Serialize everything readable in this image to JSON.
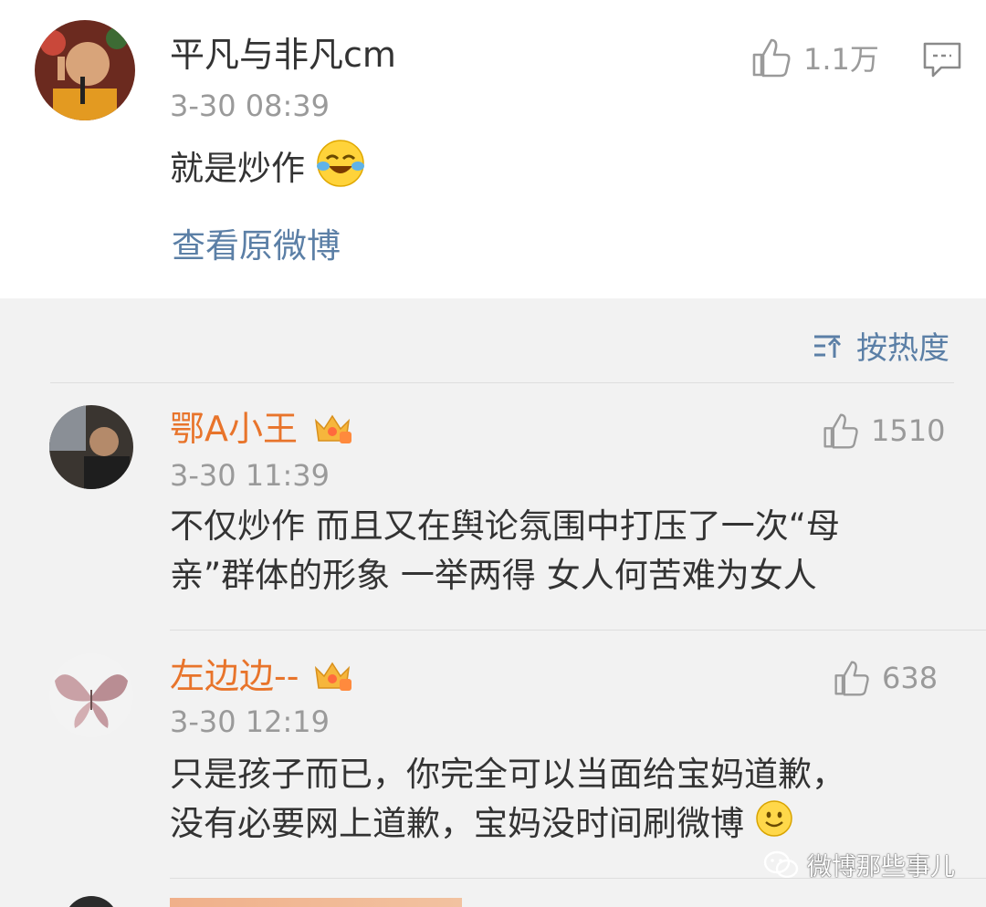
{
  "post": {
    "username": "平凡与非凡cm",
    "time": "3-30 08:39",
    "text": "就是炒作",
    "likes": "1.1万",
    "view_original": "查看原微博"
  },
  "sort": {
    "label": "按热度"
  },
  "comments": [
    {
      "username": "鄂A小王",
      "time": "3-30 11:39",
      "likes": "1510",
      "lines": [
        "不仅炒作 而且又在舆论氛围中打压了一次“母",
        "亲”群体的形象 一举两得 女人何苦难为女人"
      ]
    },
    {
      "username": "左边边--",
      "time": "3-30 12:19",
      "likes": "638",
      "lines": [
        "只是孩子而已，你完全可以当面给宝妈道歉，",
        "没有必要网上道歉，宝妈没时间刷微博"
      ]
    }
  ],
  "watermark": {
    "text": "微博那些事儿"
  },
  "colors": {
    "vip_name": "#e8742b",
    "link": "#5b7fa6",
    "meta": "#9a9a9a",
    "background": "#f2f2f2"
  },
  "icons": [
    "thumbs-up-icon",
    "comment-icon",
    "sort-icon",
    "vip-crown-icon",
    "laughing-crying-emoji",
    "smile-emoji",
    "wechat-icon"
  ]
}
